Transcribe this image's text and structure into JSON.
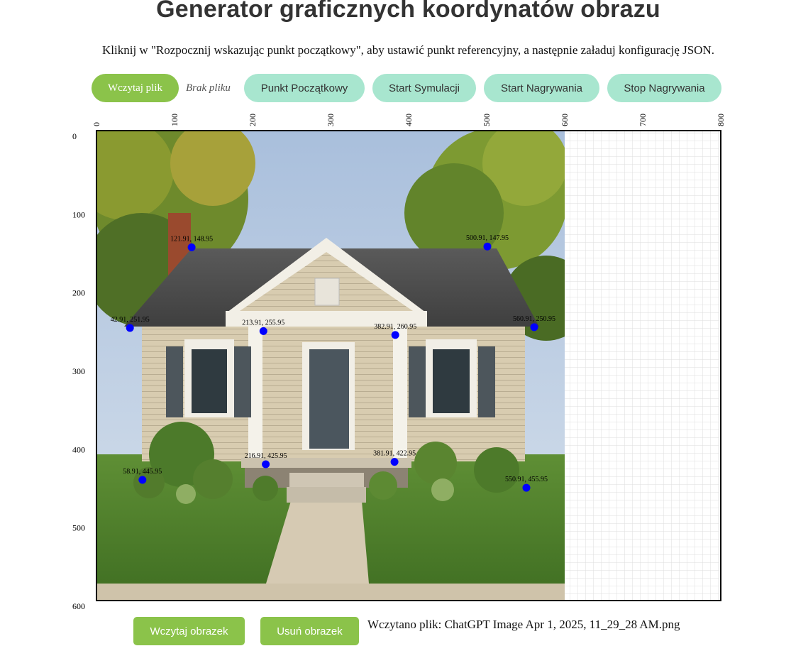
{
  "header": {
    "title": "Generator graficznych koordynatów obrazu",
    "instructions": "Kliknij w \"Rozpocznij wskazując punkt początkowy\", aby ustawić punkt referencyjny, a następnie załaduj konfigurację JSON."
  },
  "toolbar": {
    "load_file_label": "Wczytaj plik",
    "no_file_text": "Brak pliku",
    "start_point_label": "Punkt Początkowy",
    "start_simulation_label": "Start Symulacji",
    "start_recording_label": "Start Nagrywania",
    "stop_recording_label": "Stop Nagrywania"
  },
  "canvas": {
    "x_ticks": [
      "0",
      "100",
      "200",
      "300",
      "400",
      "500",
      "600",
      "700",
      "800"
    ],
    "y_ticks": [
      "0",
      "100",
      "200",
      "300",
      "400",
      "500",
      "600"
    ],
    "x_max": 800,
    "y_max": 600,
    "grid_step": 10,
    "image_extent_x": 600,
    "colors": {
      "point": "#0000ff",
      "frame": "#000000",
      "grid": "#dddddd"
    },
    "points": [
      {
        "x": 121.91,
        "y": 148.95,
        "label": "121.91, 148.95"
      },
      {
        "x": 500.91,
        "y": 147.95,
        "label": "500.91, 147.95"
      },
      {
        "x": 42.91,
        "y": 251.95,
        "label": "42.91, 251.95"
      },
      {
        "x": 213.91,
        "y": 255.95,
        "label": "213.91, 255.95"
      },
      {
        "x": 382.91,
        "y": 260.95,
        "label": "382.91, 260.95"
      },
      {
        "x": 560.91,
        "y": 250.95,
        "label": "560.91, 250.95"
      },
      {
        "x": 216.91,
        "y": 425.95,
        "label": "216.91, 425.95"
      },
      {
        "x": 381.91,
        "y": 422.95,
        "label": "381.91, 422.95"
      },
      {
        "x": 58.91,
        "y": 445.95,
        "label": "58.91, 445.95"
      },
      {
        "x": 550.91,
        "y": 455.95,
        "label": "550.91, 455.95"
      }
    ]
  },
  "bottom": {
    "load_image_label": "Wczytaj obrazek",
    "remove_image_label": "Usuń obrazek",
    "status_text": "Wczytano plik: ChatGPT Image Apr 1, 2025, 11_29_28 AM.png"
  }
}
